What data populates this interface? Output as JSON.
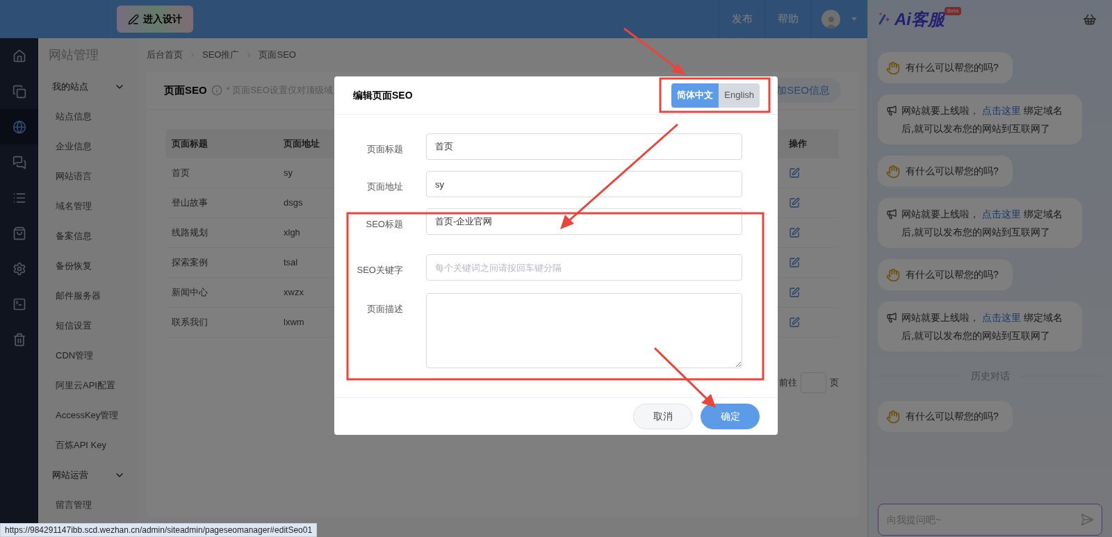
{
  "top_bar": {
    "design_button": "进入设计",
    "links": [
      "发布",
      "帮助"
    ]
  },
  "icon_rail": [
    {
      "kind": "home",
      "selected": false
    },
    {
      "kind": "copy",
      "selected": false
    },
    {
      "kind": "planet",
      "selected": true
    },
    {
      "kind": "chat",
      "selected": false
    },
    {
      "kind": "list",
      "selected": false
    },
    {
      "kind": "bag",
      "selected": false
    },
    {
      "kind": "gear",
      "selected": false
    },
    {
      "kind": "terminal",
      "selected": false
    },
    {
      "kind": "trash",
      "selected": false
    }
  ],
  "sidebar": {
    "title": "网站管理",
    "groups": [
      {
        "label": "我的站点",
        "expanded": true,
        "items": [
          "站点信息",
          "企业信息",
          "网站语言",
          "域名管理",
          "备案信息",
          "备份恢复",
          "邮件服务器",
          "短信设置",
          "CDN管理",
          "阿里云API配置",
          "AccessKey管理",
          "百炼API Key"
        ]
      },
      {
        "label": "网站运营",
        "expanded": true,
        "items": [
          "留言管理"
        ]
      }
    ]
  },
  "breadcrumb": [
    "后台首页",
    "SEO推广",
    "页面SEO"
  ],
  "card": {
    "title": "页面SEO",
    "note": "* 页面SEO设置仅对顶级域",
    "add_button": "加SEO信息"
  },
  "table": {
    "columns": [
      "页面标题",
      "页面地址",
      "操作"
    ],
    "rows": [
      {
        "title": "首页",
        "path": "sy"
      },
      {
        "title": "登山故事",
        "path": "dsgs"
      },
      {
        "title": "线路规划",
        "path": "xlgh"
      },
      {
        "title": "探索案例",
        "path": "tsal"
      },
      {
        "title": "新闻中心",
        "path": "xwzx"
      },
      {
        "title": "联系我们",
        "path": "lxwm"
      }
    ]
  },
  "pagination": {
    "goto": "前往",
    "unit": "页"
  },
  "modal": {
    "title": "编辑页面SEO",
    "languages": [
      {
        "label": "简体中文",
        "selected": true
      },
      {
        "label": "English",
        "selected": false
      }
    ],
    "fields": [
      {
        "kind": "input",
        "label": "页面标题",
        "value": "首页"
      },
      {
        "kind": "input",
        "label": "页面地址",
        "value": "sy"
      },
      {
        "kind": "input",
        "label": "SEO标题",
        "value": "首页-企业官网"
      },
      {
        "kind": "input",
        "label": "SEO关键字",
        "placeholder": "每个关键词之间请按回车键分隔"
      },
      {
        "kind": "textarea",
        "label": "页面描述"
      }
    ],
    "cancel": "取消",
    "confirm": "确定"
  },
  "chat": {
    "title": "Ai客服",
    "badge": "Beta",
    "messages": [
      {
        "kind": "greeting",
        "text": "有什么可以帮您的吗?"
      },
      {
        "kind": "notice",
        "before": "网站就要上线啦，",
        "link": "点击这里",
        "after": "绑定域名后,就可以发布您的网站到互联网了"
      },
      {
        "kind": "greeting",
        "text": "有什么可以帮您的吗?"
      },
      {
        "kind": "notice",
        "before": "网站就要上线啦，",
        "link": "点击这里",
        "after": "绑定域名后,就可以发布您的网站到互联网了"
      },
      {
        "kind": "greeting",
        "text": "有什么可以帮您的吗?"
      },
      {
        "kind": "notice",
        "before": "网站就要上线啦，",
        "link": "点击这里",
        "after": "绑定域名后,就可以发布您的网站到互联网了"
      }
    ],
    "history_label": "历史对话",
    "history": [
      {
        "kind": "greeting",
        "text": "有什么可以帮您的吗?"
      }
    ],
    "input_placeholder": "向我提问吧~"
  },
  "status_url": "https://984291147ibb.scd.wezhan.cn/admin/siteadmin/pageseomanager#editSeo01"
}
